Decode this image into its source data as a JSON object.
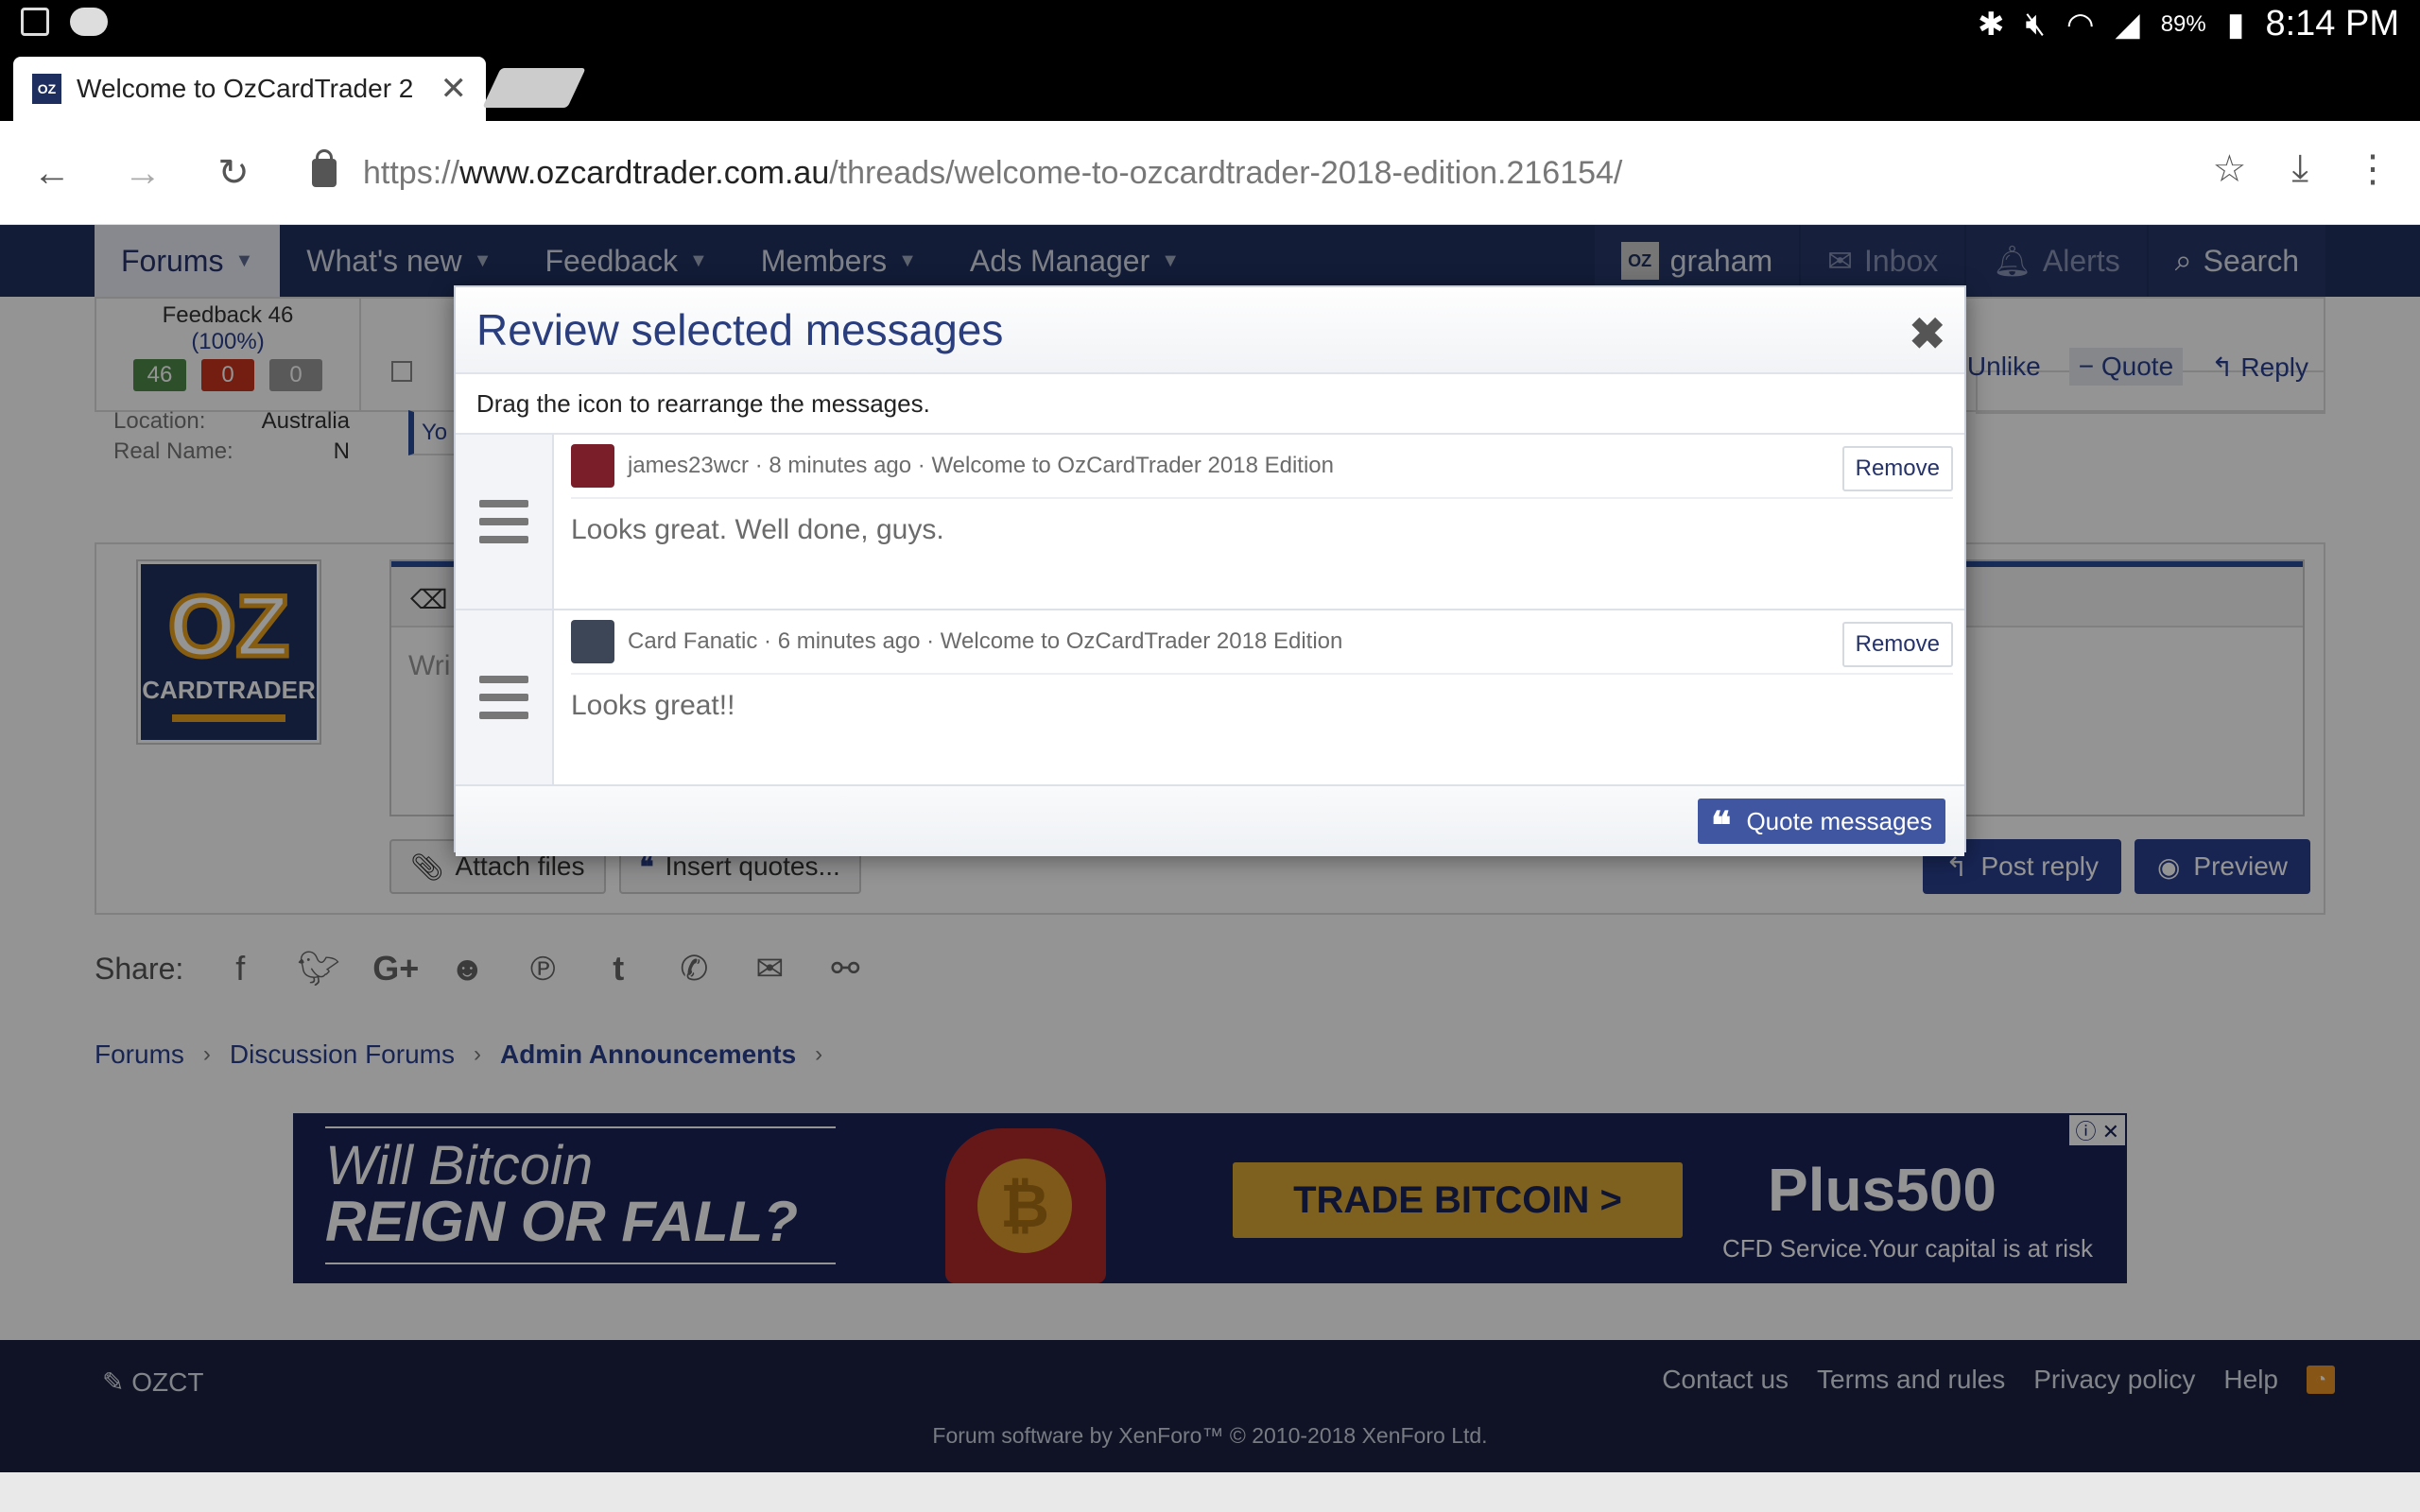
{
  "status_bar": {
    "battery": "89%",
    "time": "8:14 PM"
  },
  "browser": {
    "tab_title": "Welcome to OzCardTrader 2",
    "favicon": "OZ",
    "url_scheme": "https://",
    "url_host": "www.ozcardtrader.com.au",
    "url_path": "/threads/welcome-to-ozcardtrader-2018-edition.216154/"
  },
  "nav": {
    "items": [
      {
        "label": "Forums"
      },
      {
        "label": "What's new"
      },
      {
        "label": "Feedback"
      },
      {
        "label": "Members"
      },
      {
        "label": "Ads Manager"
      }
    ],
    "right": {
      "user": "graham",
      "inbox": "Inbox",
      "alerts": "Alerts",
      "search": "Search"
    }
  },
  "user_info": {
    "feedback_title": "Feedback 46",
    "feedback_pct": "(100%)",
    "pos": "46",
    "neg": "0",
    "neutral": "0",
    "location_label": "Location:",
    "location_value": "Australia",
    "realname_label": "Real Name:",
    "realname_value": "N"
  },
  "post_actions": {
    "unlike": "Unlike",
    "quote": "Quote",
    "reply": "Reply",
    "liked_text": "Yo"
  },
  "editor": {
    "placeholder": "Wri",
    "attach": "Attach files",
    "insert_quotes": "Insert quotes...",
    "post_reply": "Post reply",
    "preview": "Preview"
  },
  "logo": {
    "line1": "OZ",
    "line2": "CARDTRADER"
  },
  "share": {
    "label": "Share:"
  },
  "breadcrumb": [
    {
      "label": "Forums"
    },
    {
      "label": "Discussion Forums"
    },
    {
      "label": "Admin Announcements"
    }
  ],
  "ad": {
    "line1": "Will Bitcoin",
    "line2": "REIGN OR FALL?",
    "cta": "TRADE BITCOIN  >",
    "brand": "Plus500",
    "disclaimer": "CFD Service.Your capital is at risk"
  },
  "footer": {
    "brand": "OZCT",
    "links": [
      {
        "label": "Contact us"
      },
      {
        "label": "Terms and rules"
      },
      {
        "label": "Privacy policy"
      },
      {
        "label": "Help"
      }
    ],
    "copyright": "Forum software by XenForo™ © 2010-2018 XenForo Ltd."
  },
  "modal": {
    "title": "Review selected messages",
    "description": "Drag the icon to rearrange the messages.",
    "messages": [
      {
        "meta": "james23wcr · 8 minutes ago · Welcome to OzCardTrader 2018 Edition",
        "text": "Looks great. Well done, guys.",
        "remove": "Remove"
      },
      {
        "meta": "Card Fanatic · 6 minutes ago · Welcome to OzCardTrader 2018 Edition",
        "text": "Looks great!!",
        "remove": "Remove"
      }
    ],
    "quote_button": "Quote messages"
  }
}
